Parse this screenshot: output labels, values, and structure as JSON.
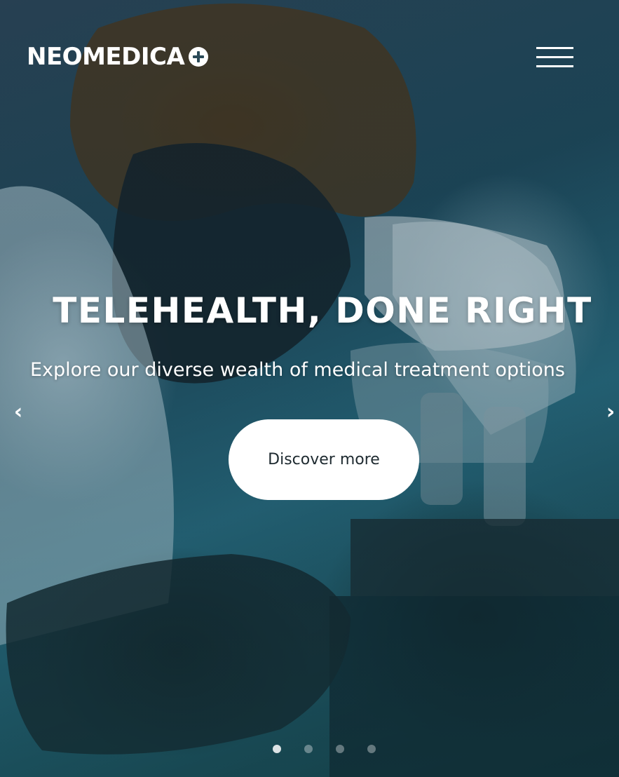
{
  "brand": {
    "name": "NEOMEDICA",
    "logo_icon": "plus-circle-icon",
    "text_color": "#ffffff"
  },
  "nav": {
    "menu_icon": "hamburger-menu-icon"
  },
  "hero": {
    "headline": "TELEHEALTH, DONE RIGHT",
    "subtitle": "Explore our diverse wealth of medical treatment options",
    "cta_label": "Discover more",
    "background_image": "scientist-looking-into-microscope",
    "prev_icon": "chevron-left-icon",
    "next_icon": "chevron-right-icon",
    "prev_glyph": "‹",
    "next_glyph": "›"
  },
  "carousel": {
    "slide_count": 4,
    "active_index": 0
  },
  "colors": {
    "overlay_tint": "#1f4a5c",
    "cta_background": "#ffffff",
    "cta_text": "#1e2a30"
  }
}
